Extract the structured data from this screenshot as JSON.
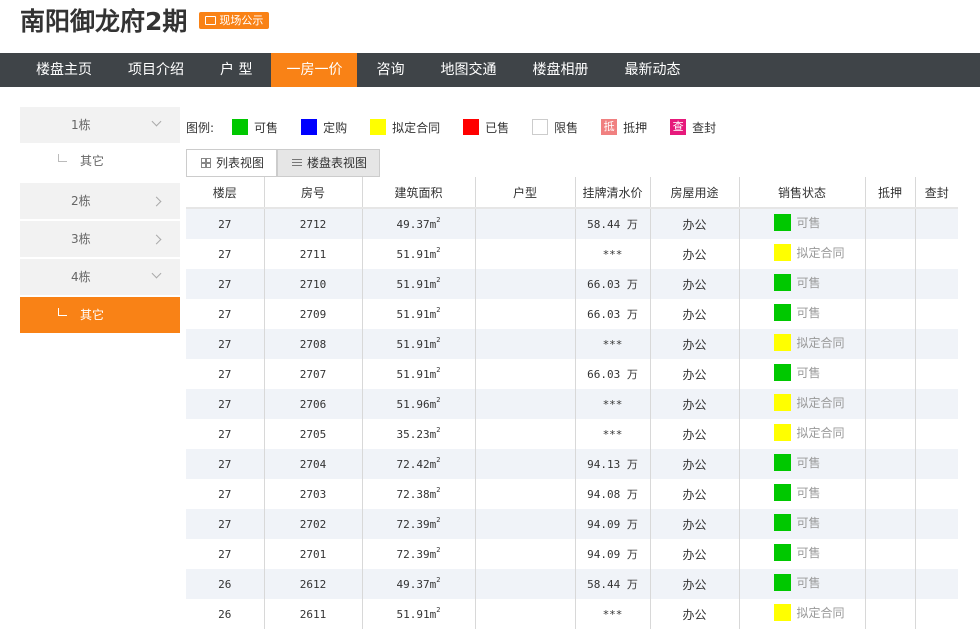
{
  "title": "南阳御龙府2期",
  "badge": "现场公示",
  "nav": [
    "楼盘主页",
    "项目介绍",
    "户 型",
    "一房一价",
    "咨询",
    "地图交通",
    "楼盘相册",
    "最新动态"
  ],
  "sidebar": [
    {
      "type": "building",
      "label": "1栋",
      "chev": "down"
    },
    {
      "type": "sub",
      "label": "其它",
      "active": false
    },
    {
      "type": "building",
      "label": "2栋",
      "chev": "right"
    },
    {
      "type": "building",
      "label": "3栋",
      "chev": "right"
    },
    {
      "type": "building",
      "label": "4栋",
      "chev": "down"
    },
    {
      "type": "sub",
      "label": "其它",
      "active": true
    }
  ],
  "legend": {
    "title": "图例:",
    "items": [
      {
        "label": "可售",
        "color": "#00c800"
      },
      {
        "label": "定购",
        "color": "#0000ff"
      },
      {
        "label": "拟定合同",
        "color": "#ffff00"
      },
      {
        "label": "已售",
        "color": "#ff0000"
      },
      {
        "label": "限售",
        "color": "#ffffff"
      },
      {
        "label": "抵押",
        "color": "#f08080",
        "glyph": "抵"
      },
      {
        "label": "查封",
        "color": "#e6197b",
        "glyph": "查"
      }
    ]
  },
  "tabs": [
    "列表视图",
    "楼盘表视图"
  ],
  "table": {
    "headers": [
      "楼层",
      "房号",
      "建筑面积",
      "户型",
      "挂牌清水价",
      "房屋用途",
      "销售状态",
      "抵押",
      "查封"
    ],
    "status_colors": {
      "可售": "#00c800",
      "拟定合同": "#ffff00"
    },
    "rows": [
      {
        "floor": "27",
        "room": "2712",
        "area": "49.37㎡",
        "layout": "",
        "price": "58.44 万",
        "use": "办公",
        "status": "可售"
      },
      {
        "floor": "27",
        "room": "2711",
        "area": "51.91㎡",
        "layout": "",
        "price": "***",
        "use": "办公",
        "status": "拟定合同"
      },
      {
        "floor": "27",
        "room": "2710",
        "area": "51.91㎡",
        "layout": "",
        "price": "66.03 万",
        "use": "办公",
        "status": "可售"
      },
      {
        "floor": "27",
        "room": "2709",
        "area": "51.91㎡",
        "layout": "",
        "price": "66.03 万",
        "use": "办公",
        "status": "可售"
      },
      {
        "floor": "27",
        "room": "2708",
        "area": "51.91㎡",
        "layout": "",
        "price": "***",
        "use": "办公",
        "status": "拟定合同"
      },
      {
        "floor": "27",
        "room": "2707",
        "area": "51.91㎡",
        "layout": "",
        "price": "66.03 万",
        "use": "办公",
        "status": "可售"
      },
      {
        "floor": "27",
        "room": "2706",
        "area": "51.96㎡",
        "layout": "",
        "price": "***",
        "use": "办公",
        "status": "拟定合同"
      },
      {
        "floor": "27",
        "room": "2705",
        "area": "35.23㎡",
        "layout": "",
        "price": "***",
        "use": "办公",
        "status": "拟定合同"
      },
      {
        "floor": "27",
        "room": "2704",
        "area": "72.42㎡",
        "layout": "",
        "price": "94.13 万",
        "use": "办公",
        "status": "可售"
      },
      {
        "floor": "27",
        "room": "2703",
        "area": "72.38㎡",
        "layout": "",
        "price": "94.08 万",
        "use": "办公",
        "status": "可售"
      },
      {
        "floor": "27",
        "room": "2702",
        "area": "72.39㎡",
        "layout": "",
        "price": "94.09 万",
        "use": "办公",
        "status": "可售"
      },
      {
        "floor": "27",
        "room": "2701",
        "area": "72.39㎡",
        "layout": "",
        "price": "94.09 万",
        "use": "办公",
        "status": "可售"
      },
      {
        "floor": "26",
        "room": "2612",
        "area": "49.37㎡",
        "layout": "",
        "price": "58.44 万",
        "use": "办公",
        "status": "可售"
      },
      {
        "floor": "26",
        "room": "2611",
        "area": "51.91㎡",
        "layout": "",
        "price": "***",
        "use": "办公",
        "status": "拟定合同"
      }
    ]
  }
}
